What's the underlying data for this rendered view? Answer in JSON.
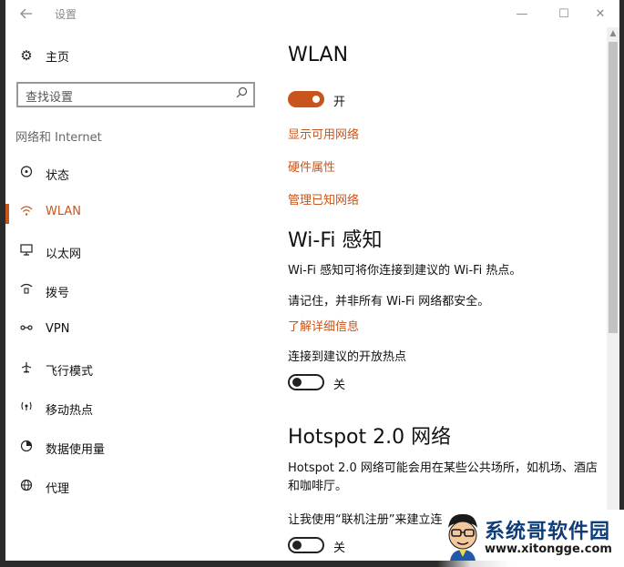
{
  "window": {
    "title": "设置",
    "back_icon": "back-arrow-icon",
    "minimize_glyph": "—",
    "maximize_glyph": "☐",
    "close_glyph": "✕"
  },
  "sidebar": {
    "home": {
      "label": "主页",
      "icon": "gear-icon"
    },
    "search": {
      "placeholder": "查找设置",
      "icon": "search-icon"
    },
    "section_label": "网络和 Internet",
    "items": [
      {
        "label": "状态",
        "icon": "status-icon",
        "active": false
      },
      {
        "label": "WLAN",
        "icon": "wifi-icon",
        "active": true
      },
      {
        "label": "以太网",
        "icon": "ethernet-icon",
        "active": false
      },
      {
        "label": "拨号",
        "icon": "dialup-icon",
        "active": false
      },
      {
        "label": "VPN",
        "icon": "vpn-icon",
        "active": false
      },
      {
        "label": "飞行模式",
        "icon": "airplane-icon",
        "active": false
      },
      {
        "label": "移动热点",
        "icon": "hotspot-icon",
        "active": false
      },
      {
        "label": "数据使用量",
        "icon": "data-usage-icon",
        "active": false
      },
      {
        "label": "代理",
        "icon": "globe-icon",
        "active": false
      }
    ]
  },
  "main": {
    "wlan_title": "WLAN",
    "wlan_toggle": {
      "state": "on",
      "label": "开"
    },
    "links": {
      "show_networks": "显示可用网络",
      "hardware_props": "硬件属性",
      "manage_known": "管理已知网络"
    },
    "wifi_sense": {
      "title": "Wi-Fi 感知",
      "desc": "Wi-Fi 感知可将你连接到建议的 Wi-Fi 热点。",
      "note": "请记住，并非所有 Wi-Fi 网络都安全。",
      "learn_more": "了解详细信息",
      "connect_label": "连接到建议的开放热点",
      "toggle": {
        "state": "off",
        "label": "关"
      }
    },
    "hotspot": {
      "title": "Hotspot 2.0 网络",
      "desc": "Hotspot 2.0 网络可能会用在某些公共场所，如机场、酒店和咖啡厅。",
      "option_label": "让我使用“联机注册”来建立连",
      "toggle": {
        "state": "off",
        "label": "关"
      }
    }
  },
  "watermark": {
    "name": "系统哥软件园",
    "url": "www.xitongge.com"
  },
  "colors": {
    "accent": "#c8551b",
    "text": "#111111",
    "muted": "#666666"
  }
}
